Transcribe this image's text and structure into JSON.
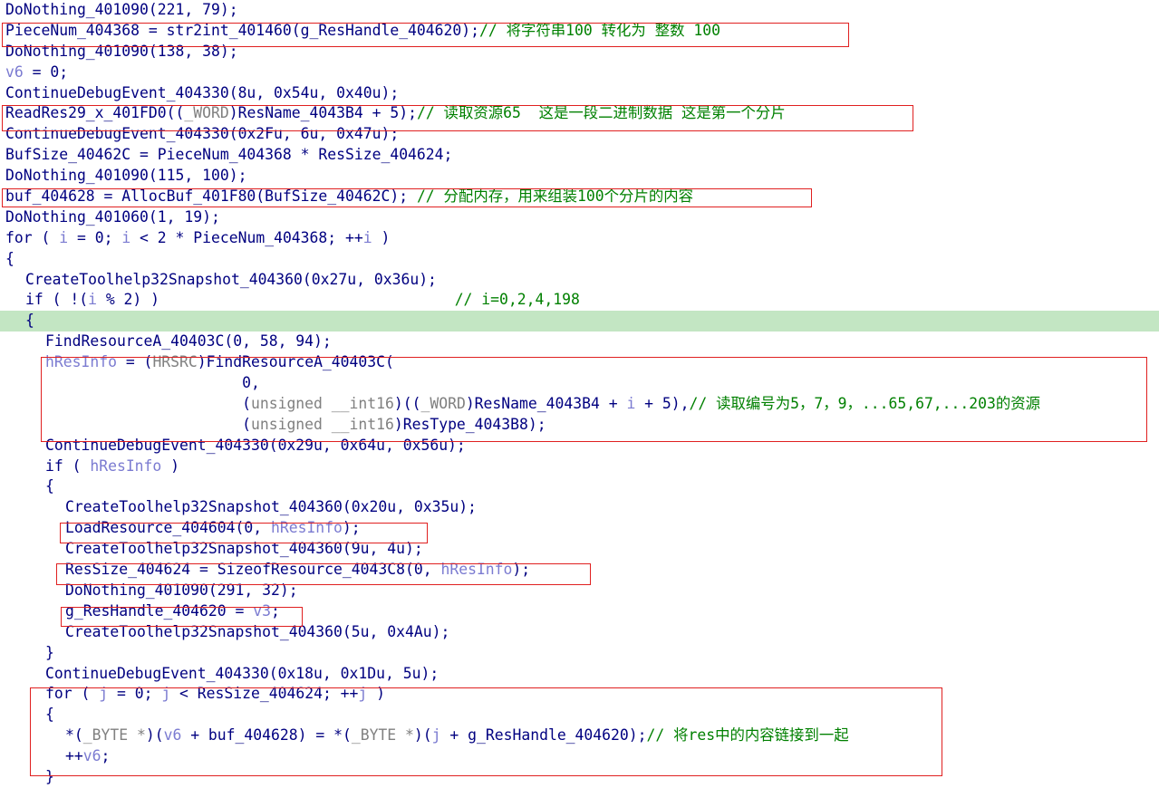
{
  "lines": [
    {
      "indent": 0,
      "hl": false,
      "tokens": [
        {
          "t": "DoNothing_401090(221, 79);",
          "c": "n"
        }
      ]
    },
    {
      "indent": 0,
      "hl": false,
      "tokens": [
        {
          "t": "PieceNum_404368 = str2int_401460(g_ResHandle_404620);",
          "c": "n"
        },
        {
          "t": "// 将字符串100 转化为 整数 100",
          "c": "c"
        }
      ]
    },
    {
      "indent": 0,
      "hl": false,
      "tokens": [
        {
          "t": "DoNothing_401090(138, 38);",
          "c": "n"
        }
      ]
    },
    {
      "indent": 0,
      "hl": false,
      "tokens": [
        {
          "t": "v6",
          "c": "v"
        },
        {
          "t": " = 0;",
          "c": "n"
        }
      ]
    },
    {
      "indent": 0,
      "hl": false,
      "tokens": [
        {
          "t": "ContinueDebugEvent_404330(8u, 0x54u, 0x40u);",
          "c": "n"
        }
      ]
    },
    {
      "indent": 0,
      "hl": false,
      "tokens": [
        {
          "t": "ReadRes29_x_401FD0((",
          "c": "n"
        },
        {
          "t": "_WORD",
          "c": "g"
        },
        {
          "t": ")ResName_4043B4 + 5);",
          "c": "n"
        },
        {
          "t": "// 读取资源65  这是一段二进制数据 这是第一个分片",
          "c": "c"
        }
      ]
    },
    {
      "indent": 0,
      "hl": false,
      "tokens": [
        {
          "t": "ContinueDebugEvent_404330(0x2Fu, 6u, 0x47u);",
          "c": "n"
        }
      ]
    },
    {
      "indent": 0,
      "hl": false,
      "tokens": [
        {
          "t": "BufSize_40462C = PieceNum_404368 * ResSize_404624;",
          "c": "n"
        }
      ]
    },
    {
      "indent": 0,
      "hl": false,
      "tokens": [
        {
          "t": "DoNothing_401090(115, 100);",
          "c": "n"
        }
      ]
    },
    {
      "indent": 0,
      "hl": false,
      "tokens": [
        {
          "t": "buf_404628 = AllocBuf_401F80(BufSize_40462C); ",
          "c": "n"
        },
        {
          "t": "// 分配内存，用来组装100个分片的内容",
          "c": "c"
        }
      ]
    },
    {
      "indent": 0,
      "hl": false,
      "tokens": [
        {
          "t": "DoNothing_401060(1, 19);",
          "c": "n"
        }
      ]
    },
    {
      "indent": 0,
      "hl": false,
      "tokens": [
        {
          "t": "for ( ",
          "c": "n"
        },
        {
          "t": "i",
          "c": "v"
        },
        {
          "t": " = 0; ",
          "c": "n"
        },
        {
          "t": "i",
          "c": "v"
        },
        {
          "t": " < 2 * PieceNum_404368; ++",
          "c": "n"
        },
        {
          "t": "i",
          "c": "v"
        },
        {
          "t": " )",
          "c": "n"
        }
      ]
    },
    {
      "indent": 0,
      "hl": false,
      "tokens": [
        {
          "t": "{",
          "c": "n"
        }
      ]
    },
    {
      "indent": 1,
      "hl": false,
      "tokens": [
        {
          "t": "CreateToolhelp32Snapshot_404360(0x27u, 0x36u);",
          "c": "n"
        }
      ]
    },
    {
      "indent": 1,
      "hl": false,
      "tokens": [
        {
          "t": "if ( !(",
          "c": "n"
        },
        {
          "t": "i",
          "c": "v"
        },
        {
          "t": " % 2) )                                 ",
          "c": "n"
        },
        {
          "t": "// i=0,2,4,198",
          "c": "c"
        }
      ]
    },
    {
      "indent": 1,
      "hl": true,
      "tokens": [
        {
          "t": "{",
          "c": "n"
        }
      ]
    },
    {
      "indent": 2,
      "hl": false,
      "tokens": [
        {
          "t": "FindResourceA_40403C(0, 58, 94);",
          "c": "n"
        }
      ]
    },
    {
      "indent": 2,
      "hl": false,
      "tokens": [
        {
          "t": "hResInfo",
          "c": "v"
        },
        {
          "t": " = (",
          "c": "n"
        },
        {
          "t": "HRSRC",
          "c": "g"
        },
        {
          "t": ")FindResourceA_40403C(",
          "c": "n"
        }
      ]
    },
    {
      "indent": 2,
      "hl": false,
      "tokens": [
        {
          "t": "                      0,",
          "c": "n"
        }
      ]
    },
    {
      "indent": 2,
      "hl": false,
      "tokens": [
        {
          "t": "                      (",
          "c": "n"
        },
        {
          "t": "unsigned __int16",
          "c": "g"
        },
        {
          "t": ")((",
          "c": "n"
        },
        {
          "t": "_WORD",
          "c": "g"
        },
        {
          "t": ")ResName_4043B4 + ",
          "c": "n"
        },
        {
          "t": "i",
          "c": "v"
        },
        {
          "t": " + 5),",
          "c": "n"
        },
        {
          "t": "// 读取编号为5，7，9，...65,67,...203的资源",
          "c": "c"
        }
      ]
    },
    {
      "indent": 2,
      "hl": false,
      "tokens": [
        {
          "t": "                      (",
          "c": "n"
        },
        {
          "t": "unsigned __int16",
          "c": "g"
        },
        {
          "t": ")ResType_4043B8);",
          "c": "n"
        }
      ]
    },
    {
      "indent": 2,
      "hl": false,
      "tokens": [
        {
          "t": "ContinueDebugEvent_404330(0x29u, 0x64u, 0x56u);",
          "c": "n"
        }
      ]
    },
    {
      "indent": 2,
      "hl": false,
      "tokens": [
        {
          "t": "if ( ",
          "c": "n"
        },
        {
          "t": "hResInfo",
          "c": "v"
        },
        {
          "t": " )",
          "c": "n"
        }
      ]
    },
    {
      "indent": 2,
      "hl": false,
      "tokens": [
        {
          "t": "{",
          "c": "n"
        }
      ]
    },
    {
      "indent": 3,
      "hl": false,
      "tokens": [
        {
          "t": "CreateToolhelp32Snapshot_404360(0x20u, 0x35u);",
          "c": "n"
        }
      ]
    },
    {
      "indent": 3,
      "hl": false,
      "tokens": [
        {
          "t": "LoadResource_404604(0, ",
          "c": "n"
        },
        {
          "t": "hResInfo",
          "c": "v"
        },
        {
          "t": ");",
          "c": "n"
        }
      ]
    },
    {
      "indent": 3,
      "hl": false,
      "tokens": [
        {
          "t": "CreateToolhelp32Snapshot_404360(9u, 4u);",
          "c": "n"
        }
      ]
    },
    {
      "indent": 3,
      "hl": false,
      "tokens": [
        {
          "t": "ResSize_404624 = SizeofResource_4043C8(0, ",
          "c": "n"
        },
        {
          "t": "hResInfo",
          "c": "v"
        },
        {
          "t": ");",
          "c": "n"
        }
      ]
    },
    {
      "indent": 3,
      "hl": false,
      "tokens": [
        {
          "t": "DoNothing_401090(291, 32);",
          "c": "n"
        }
      ]
    },
    {
      "indent": 3,
      "hl": false,
      "tokens": [
        {
          "t": "g_ResHandle_404620 = ",
          "c": "n"
        },
        {
          "t": "v3",
          "c": "v"
        },
        {
          "t": ";",
          "c": "n"
        }
      ]
    },
    {
      "indent": 3,
      "hl": false,
      "tokens": [
        {
          "t": "CreateToolhelp32Snapshot_404360(5u, 0x4Au);",
          "c": "n"
        }
      ]
    },
    {
      "indent": 2,
      "hl": false,
      "tokens": [
        {
          "t": "}",
          "c": "n"
        }
      ]
    },
    {
      "indent": 2,
      "hl": false,
      "tokens": [
        {
          "t": "ContinueDebugEvent_404330(0x18u, 0x1Du, 5u);",
          "c": "n"
        }
      ]
    },
    {
      "indent": 2,
      "hl": false,
      "tokens": [
        {
          "t": "for ( ",
          "c": "n"
        },
        {
          "t": "j",
          "c": "v"
        },
        {
          "t": " = 0; ",
          "c": "n"
        },
        {
          "t": "j",
          "c": "v"
        },
        {
          "t": " < ResSize_404624; ++",
          "c": "n"
        },
        {
          "t": "j",
          "c": "v"
        },
        {
          "t": " )",
          "c": "n"
        }
      ]
    },
    {
      "indent": 2,
      "hl": false,
      "tokens": [
        {
          "t": "{",
          "c": "n"
        }
      ]
    },
    {
      "indent": 3,
      "hl": false,
      "tokens": [
        {
          "t": "*(",
          "c": "n"
        },
        {
          "t": "_BYTE *",
          "c": "g"
        },
        {
          "t": ")(",
          "c": "n"
        },
        {
          "t": "v6",
          "c": "v"
        },
        {
          "t": " + buf_404628) = *(",
          "c": "n"
        },
        {
          "t": "_BYTE *",
          "c": "g"
        },
        {
          "t": ")(",
          "c": "n"
        },
        {
          "t": "j",
          "c": "v"
        },
        {
          "t": " + g_ResHandle_404620);",
          "c": "n"
        },
        {
          "t": "// 将res中的内容链接到一起",
          "c": "c"
        }
      ]
    },
    {
      "indent": 3,
      "hl": false,
      "tokens": [
        {
          "t": "++",
          "c": "n"
        },
        {
          "t": "v6",
          "c": "v"
        },
        {
          "t": ";",
          "c": "n"
        }
      ]
    },
    {
      "indent": 2,
      "hl": false,
      "tokens": [
        {
          "t": "}",
          "c": "n"
        }
      ]
    }
  ],
  "annotation_color": "#e02020",
  "highlight_color": "#c3e6c3"
}
